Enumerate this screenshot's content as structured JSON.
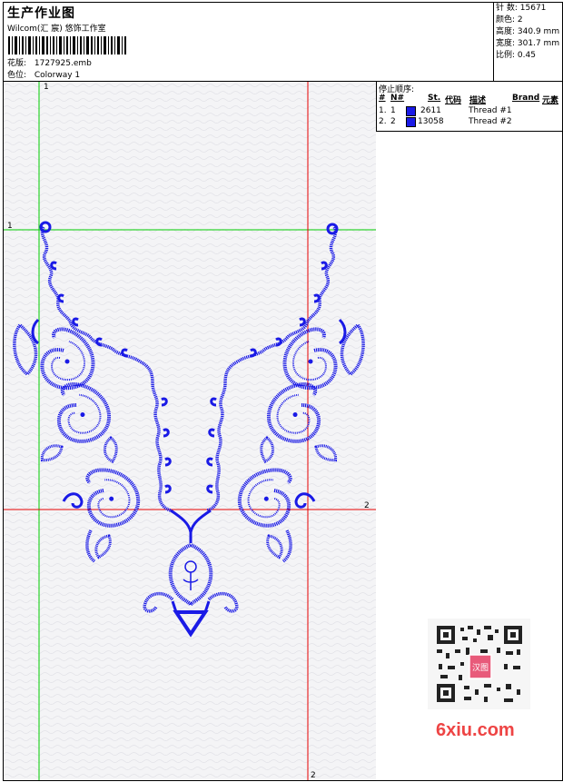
{
  "header": {
    "title": "生产作业图",
    "subtitle": "Wilcom(汇 宸) 悠饰工作室",
    "design_label": "花版:",
    "design_value": "1727925.emb",
    "colorway_label": "色位:",
    "colorway_value": "Colorway 1"
  },
  "stats": [
    {
      "label": "针 数:",
      "value": "15671"
    },
    {
      "label": "颜色:",
      "value": "2"
    },
    {
      "label": "高度:",
      "value": "340.9 mm"
    },
    {
      "label": "宽度:",
      "value": "301.7 mm"
    },
    {
      "label": "比例:",
      "value": "0.45"
    }
  ],
  "stop_sequence": {
    "caption": "停止顺序:",
    "columns": {
      "num": "#",
      "n": "N#",
      "st": "St.",
      "code": "代码",
      "desc": "描述",
      "brand": "Brand",
      "elem": "元素"
    },
    "rows": [
      {
        "num": "1.",
        "n": "1",
        "code": "2611",
        "desc": "Thread #1",
        "color": "#1a1ae6"
      },
      {
        "num": "2.",
        "n": "2",
        "code": "13058",
        "desc": "Thread #2",
        "color": "#1a1ae6"
      }
    ]
  },
  "guides": {
    "green_v_label": "1",
    "green_h_label": "1",
    "red_h_label": "2",
    "red_v_label": "2"
  },
  "watermark": {
    "stamp_text": "汉图",
    "brand_text": "6xiu.com"
  }
}
